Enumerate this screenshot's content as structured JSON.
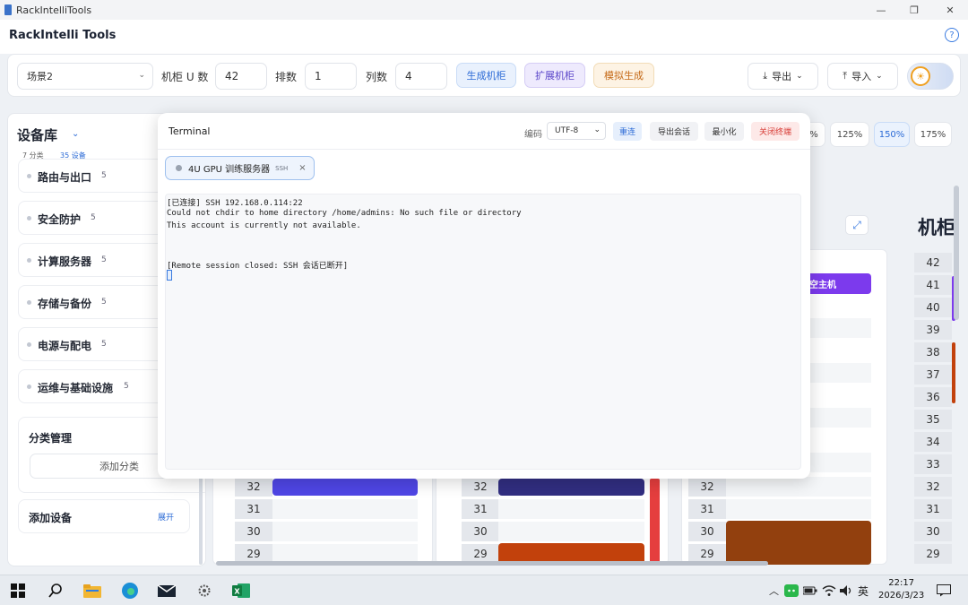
{
  "window": {
    "title": "RackIntelliTools",
    "minimize": "—",
    "restore": "❐",
    "close": "✕"
  },
  "header": {
    "app_title": "RackIntelli Tools",
    "help": "?"
  },
  "toolbar": {
    "scene": "场景2",
    "rack_u_label": "机柜 U 数",
    "rack_u_value": "42",
    "rows_label": "排数",
    "rows_value": "1",
    "cols_label": "列数",
    "cols_value": "4",
    "gen_rack": "生成机柜",
    "expand_rack": "扩展机柜",
    "sim_gen": "模拟生成",
    "export": "导出",
    "import": "导入"
  },
  "library": {
    "title": "设备库",
    "categories_count": "7 分类",
    "devices_count": "35 设备",
    "categories": [
      {
        "label": "路由与出口",
        "count": "5"
      },
      {
        "label": "安全防护",
        "count": "5"
      },
      {
        "label": "计算服务器",
        "count": "5"
      },
      {
        "label": "存储与备份",
        "count": "5"
      },
      {
        "label": "电源与配电",
        "count": "5"
      },
      {
        "label": "运维与基础设施",
        "count": "5"
      }
    ],
    "category_mgmt": "分类管理",
    "add_category": "添加分类",
    "add_device": "添加设备",
    "expand": "展开"
  },
  "zoom": {
    "partial": "%",
    "z125": "125%",
    "z150": "150%",
    "z175": "175%",
    "active": "150%"
  },
  "rack": {
    "title": "机柜",
    "device_partial_label": "空主机",
    "units_left": [
      "32",
      "31",
      "30",
      "29"
    ],
    "units_right": [
      "42",
      "41",
      "40",
      "39",
      "38",
      "37",
      "36",
      "35",
      "34",
      "33",
      "32",
      "31",
      "30",
      "29"
    ]
  },
  "terminal": {
    "title": "Terminal",
    "encoding_label": "编码",
    "encoding": "UTF-8",
    "reconnect": "重连",
    "export_session": "导出会话",
    "minimize": "最小化",
    "close_terminal": "关闭终端",
    "tab_name": "4U GPU 训练服务器",
    "tab_tag": "SSH",
    "tab_close": "×",
    "lines": [
      "[已连接] SSH 192.168.0.114:22",
      "Could not chdir to home directory /home/admins: No such file or directory",
      "This account is currently not available.",
      "",
      "[Remote session closed: SSH 会话已断开]"
    ]
  },
  "taskbar": {
    "time": "22:17",
    "date": "2026/3/23",
    "ime": "英",
    "tray_up": "︿"
  },
  "colors": {
    "accent": "#2c6bd6",
    "purple_dev": "#7c3aed",
    "navy_dev": "#312e81",
    "orange_dev": "#c2410c",
    "brown_dev": "#92400e",
    "red_bar": "#e53e3e"
  }
}
